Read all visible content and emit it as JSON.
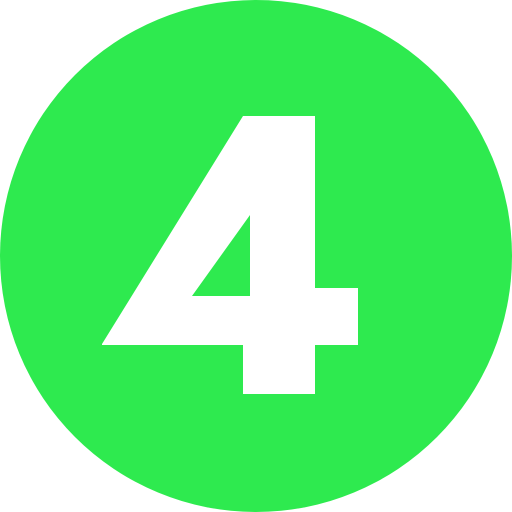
{
  "badge": {
    "number": "4",
    "background_color": "#2eea4f",
    "number_color": "#ffffff"
  }
}
